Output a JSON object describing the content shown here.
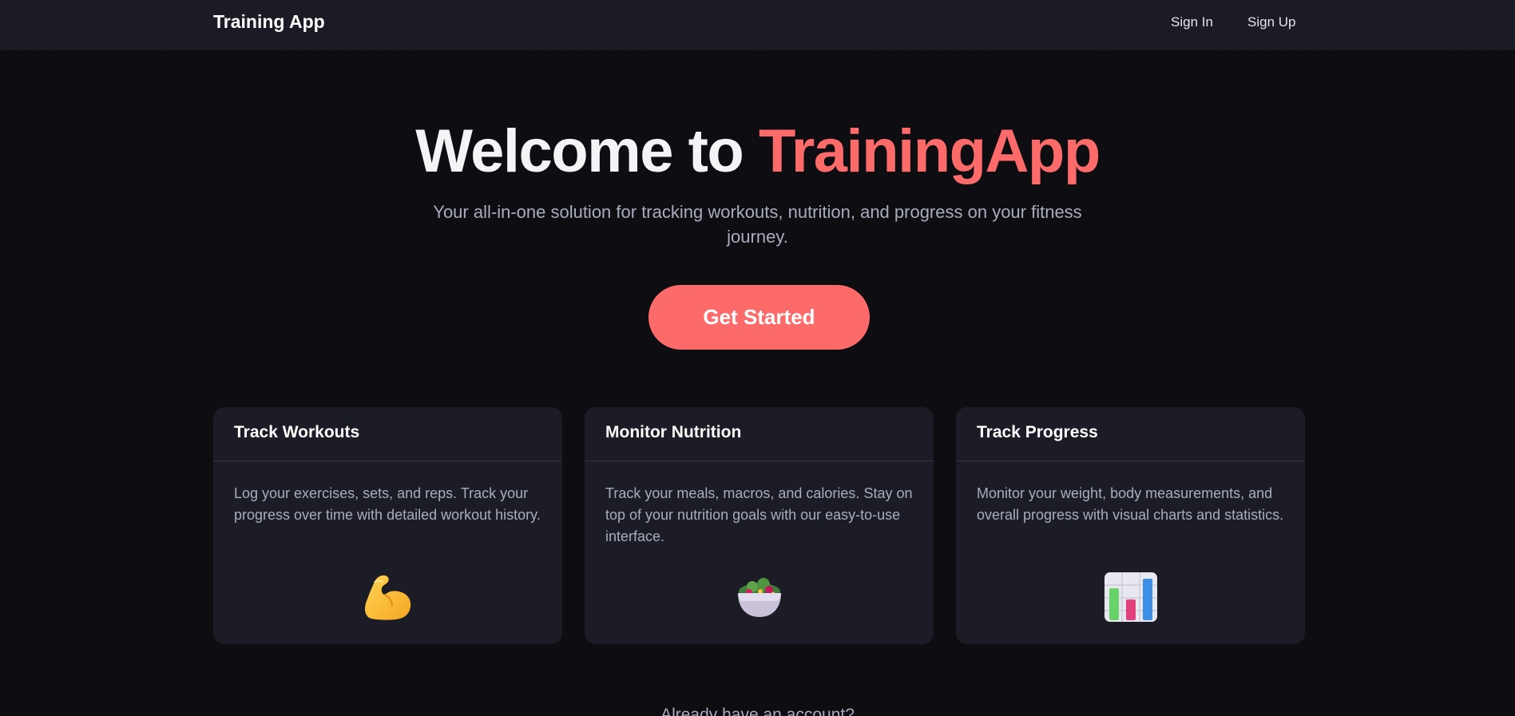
{
  "nav": {
    "brand": "Training App",
    "sign_in": "Sign In",
    "sign_up": "Sign Up"
  },
  "hero": {
    "title_prefix": "Welcome to ",
    "title_accent": "TrainingApp",
    "subtitle": "Your all-in-one solution for tracking workouts, nutrition, and progress on your fitness journey.",
    "cta": "Get Started"
  },
  "features": [
    {
      "title": "Track Workouts",
      "description": "Log your exercises, sets, and reps. Track your progress over time with detailed workout history.",
      "icon": "flexed-biceps-icon"
    },
    {
      "title": "Monitor Nutrition",
      "description": "Track your meals, macros, and calories. Stay on top of your nutrition goals with our easy-to-use interface.",
      "icon": "salad-bowl-icon"
    },
    {
      "title": "Track Progress",
      "description": "Monitor your weight, body measurements, and overall progress with visual charts and statistics.",
      "icon": "bar-chart-icon"
    }
  ],
  "footer": {
    "account_prompt": "Already have an account?"
  },
  "colors": {
    "background": "#0e0d12",
    "navbar": "#1b1b25",
    "card": "#1c1c26",
    "accent": "#fd6a6a",
    "muted_text": "#a8adbd"
  }
}
